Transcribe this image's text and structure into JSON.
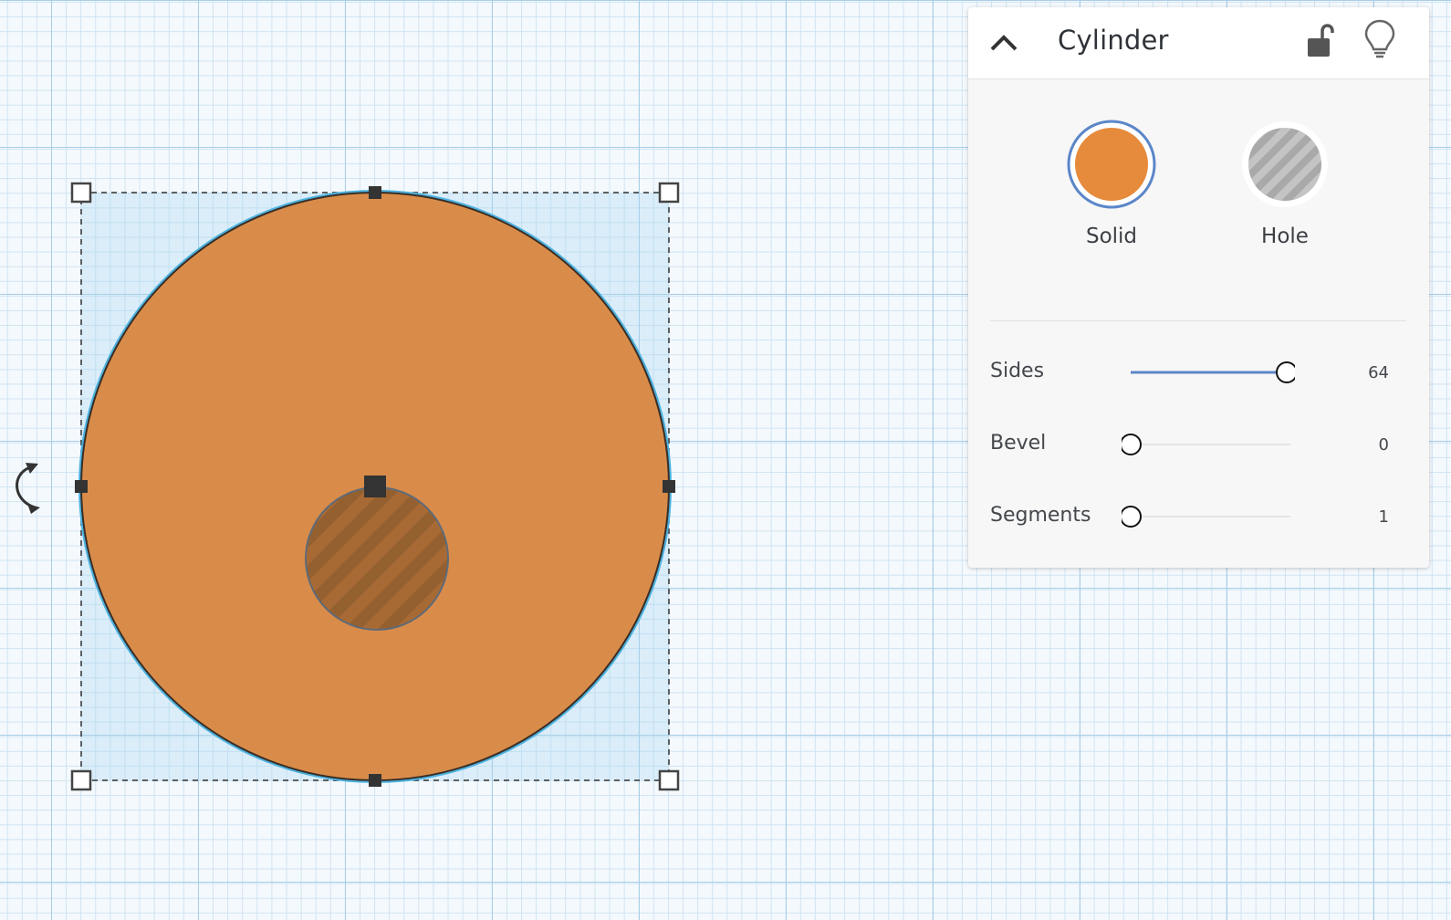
{
  "panel": {
    "title": "Cylinder",
    "collapse_icon": "chevron-up-icon",
    "lock_icon": "unlocked-padlock-icon",
    "visibility_icon": "lightbulb-icon",
    "options": [
      {
        "label": "Solid",
        "selected": true,
        "color": "#e68a3c"
      },
      {
        "label": "Hole",
        "selected": false
      }
    ],
    "properties": [
      {
        "label": "Sides",
        "value": "64",
        "fraction": 1.0
      },
      {
        "label": "Bevel",
        "value": "0",
        "fraction": 0.0
      },
      {
        "label": "Segments",
        "value": "1",
        "fraction": 0.0
      }
    ]
  },
  "colors": {
    "shape_fill": "#d98c4a",
    "selection_accent": "#4cb2e0",
    "slider_track_active": "#5b86c9",
    "grid_line": "#a9cde6"
  }
}
